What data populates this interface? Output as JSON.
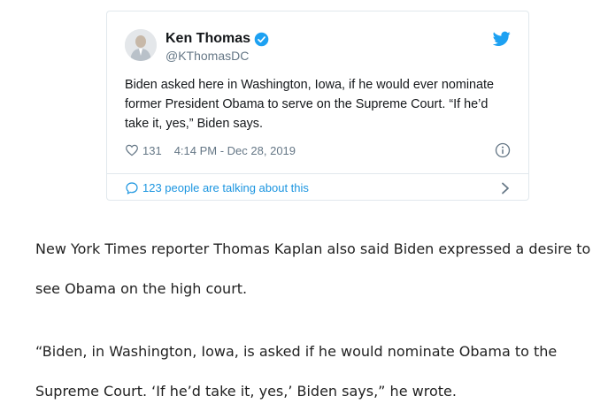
{
  "tweet": {
    "author_name": "Ken Thomas",
    "handle": "@KThomasDC",
    "text": "Biden asked here in Washington, Iowa, if he would ever nominate former President Obama to serve on the Supreme Court. “If he’d take it, yes,” Biden says.",
    "like_count": "131",
    "timestamp": "4:14 PM - Dec 28, 2019",
    "conversation_label": "123 people are talking about this",
    "icons": {
      "verified": "verified-badge-icon",
      "logo": "twitter-bird-icon",
      "like": "heart-icon",
      "info": "info-icon",
      "conversation": "speech-bubble-icon",
      "chevron": "chevron-right-icon"
    },
    "colors": {
      "accent": "#1da1f2",
      "link": "#1b95e0",
      "muted": "#657786",
      "border": "#e1e8ed"
    }
  },
  "article": {
    "paragraph_1": "New York Times reporter Thomas Kaplan also said Biden expressed a desire to see Obama on the high court.",
    "paragraph_2": "“Biden, in Washington, Iowa, is asked if he would nominate Obama to the Supreme Court. ‘If he’d take it, yes,’ Biden says,” he wrote."
  }
}
